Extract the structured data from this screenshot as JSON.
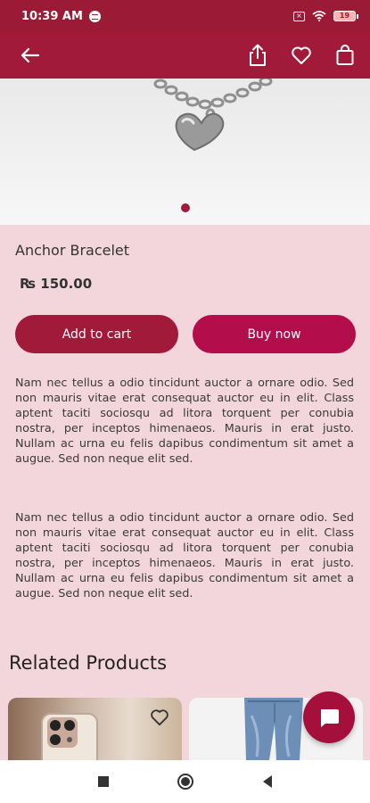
{
  "status_bar": {
    "time": "10:39 AM",
    "battery": "19"
  },
  "product": {
    "title": "Anchor Bracelet",
    "price": "₨ 150.00",
    "add_to_cart_label": "Add to cart",
    "buy_now_label": "Buy now",
    "description_1": "Nam nec tellus a odio tincidunt auctor a ornare odio. Sed non mauris vitae erat consequat auctor eu in elit. Class aptent taciti sociosqu ad litora torquent per conubia nostra, per inceptos himenaeos. Mauris in erat justo. Nullam ac urna eu felis dapibus condimentum sit amet a augue. Sed non neque elit sed.",
    "description_2": "Nam nec tellus a odio tincidunt auctor a ornare odio. Sed non mauris vitae erat consequat auctor eu in elit. Class aptent taciti sociosqu ad litora torquent per conubia nostra, per inceptos himenaeos. Mauris in erat justo. Nullam ac urna eu felis dapibus condimentum sit amet a augue. Sed non neque elit sed."
  },
  "related": {
    "title": "Related Products"
  },
  "icons": {
    "back": "arrow-left-icon",
    "share": "share-icon",
    "wishlist": "heart-icon",
    "bag": "shopping-bag-icon",
    "chat": "chat-icon"
  },
  "colors": {
    "primary": "#a11a3a",
    "accent": "#b40d4c",
    "background": "#f2d6dc"
  }
}
